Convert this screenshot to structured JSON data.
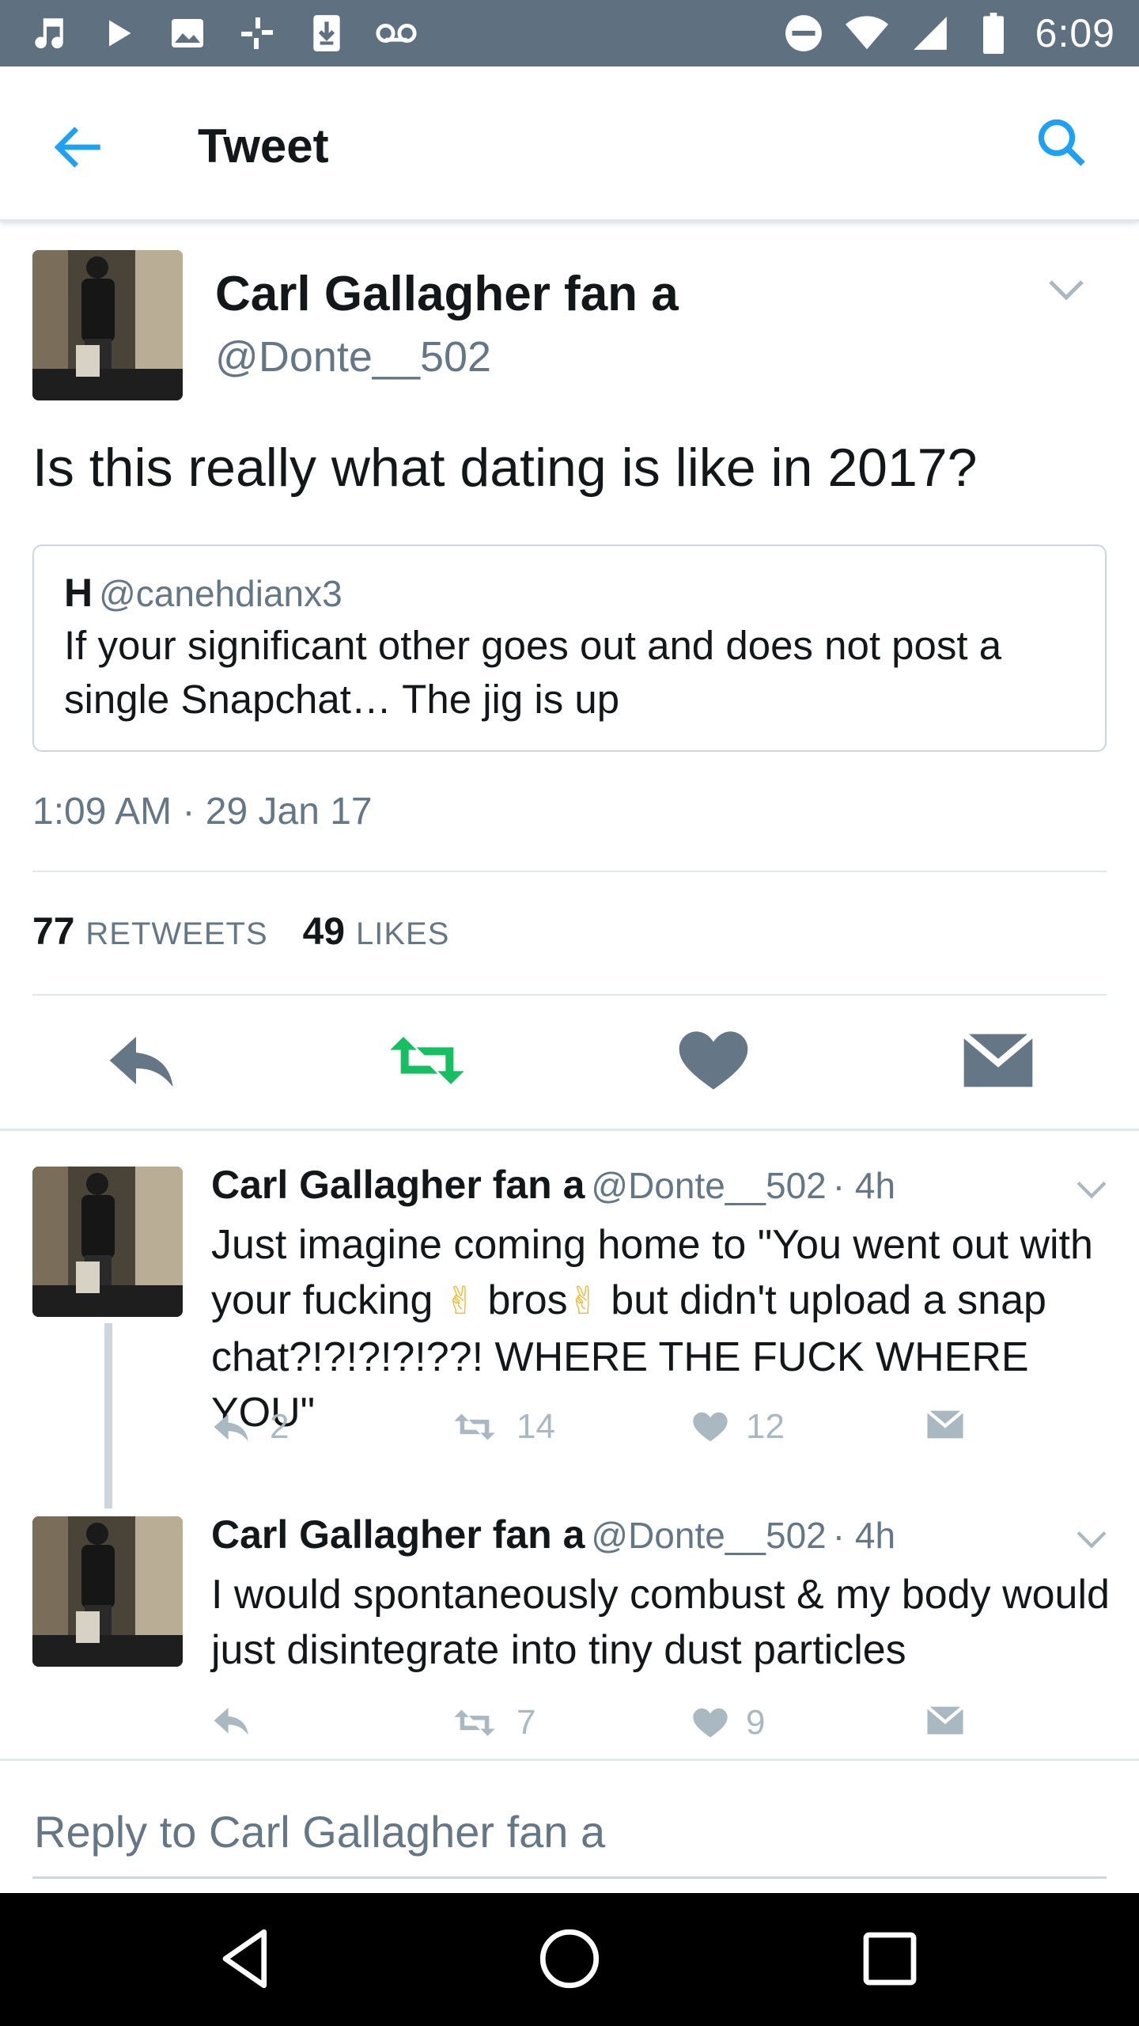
{
  "status_bar": {
    "time": "6:09",
    "left_icons": [
      "music-icon",
      "play-icon",
      "image-icon",
      "pinwheel-icon",
      "download-icon",
      "voicemail-icon"
    ],
    "right_icons": [
      "do-not-disturb-icon",
      "wifi-icon",
      "signal-icon",
      "battery-icon"
    ]
  },
  "toolbar": {
    "title": "Tweet"
  },
  "main_tweet": {
    "author_name": "Carl Gallagher fan a",
    "author_handle": "@Donte__502",
    "text": "Is this really what dating is like in 2017?",
    "quote": {
      "name": "H",
      "handle": "@canehdianx3",
      "text": "If your significant other goes out and does not post a single Snapchat… The jig is up"
    },
    "timestamp": "1:09 AM · 29 Jan 17",
    "retweets_count": "77",
    "retweets_label": "RETWEETS",
    "likes_count": "49",
    "likes_label": "LIKES"
  },
  "replies": [
    {
      "author_name": "Carl Gallagher fan a",
      "author_handle": "@Donte__502",
      "time": "· 4h",
      "text_before_emoji1": "Just imagine coming home to \"You went out with your fucking ",
      "emoji": "✌",
      "text_mid": "bros",
      "text_after": " but didn't upload a snap chat?!?!?!?!??! WHERE THE FUCK WHERE YOU\"",
      "reply_count": "2",
      "retweet_count": "14",
      "like_count": "12"
    },
    {
      "author_name": "Carl Gallagher fan a",
      "author_handle": "@Donte__502",
      "time": "· 4h",
      "text": "I would spontaneously combust & my body would just disintegrate into tiny dust particles",
      "retweet_count": "7",
      "like_count": "9"
    }
  ],
  "reply_box": {
    "placeholder": "Reply to Carl Gallagher fan a"
  },
  "colors": {
    "status_bar": "#5f7181",
    "accent": "#1da1f2",
    "retweet_green": "#17bf63",
    "icon_gray": "#657786",
    "muted": "#aab8c2"
  }
}
